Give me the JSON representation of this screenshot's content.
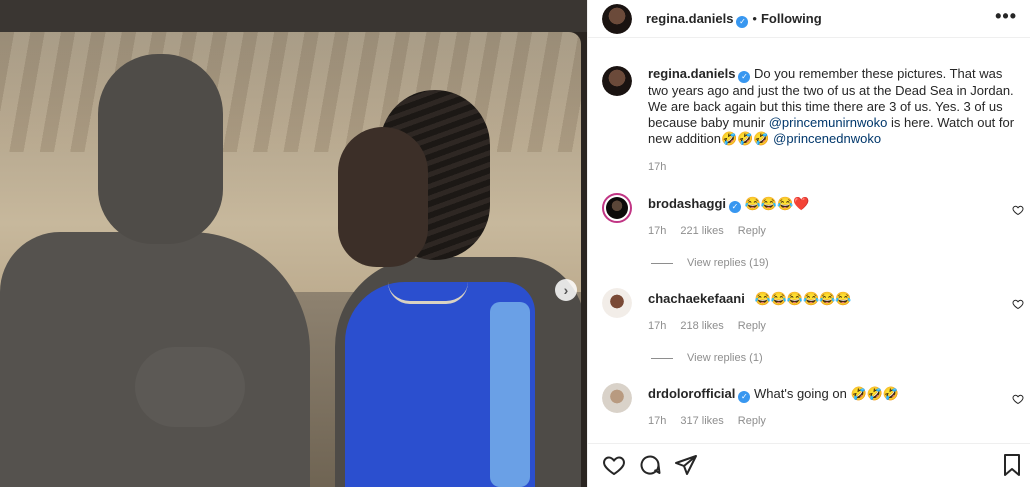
{
  "post": {
    "author": "regina.daniels",
    "follow_status": "Following",
    "separator": "•",
    "more_label": "•••",
    "next_label": "›"
  },
  "caption": {
    "author": "regina.daniels",
    "text_part1": "Do you remember these pictures. That was two years ago and just the two of us at the Dead Sea in Jordan. We are back again but this time there are 3 of us. Yes. 3 of us because baby munir ",
    "mention1": "@princemunirnwoko",
    "text_part2": " is here. Watch out for new addition🤣🤣🤣 ",
    "mention2": "@princenednwoko",
    "time": "17h"
  },
  "comments": [
    {
      "author": "brodashaggi",
      "text": "😂😂😂❤️",
      "time": "17h",
      "likes": "221 likes",
      "reply": "Reply",
      "view_replies": "View replies (19)"
    },
    {
      "author": "chachaekefaani",
      "text": "😂😂😂😂😂😂",
      "time": "17h",
      "likes": "218 likes",
      "reply": "Reply",
      "view_replies": "View replies (1)"
    },
    {
      "author": "drdolorofficial",
      "text": "What's going on 🤣🤣🤣",
      "time": "17h",
      "likes": "317 likes",
      "reply": "Reply"
    }
  ],
  "icons": {
    "verified": "verified-badge-icon",
    "more": "more-options-icon",
    "like": "heart-icon",
    "comment": "comment-icon",
    "share": "paper-plane-icon",
    "save": "bookmark-icon",
    "next": "chevron-right-icon"
  },
  "colors": {
    "verified": "#3897f0",
    "link": "#00376b",
    "muted": "#8e8e8e",
    "text": "#262626"
  }
}
